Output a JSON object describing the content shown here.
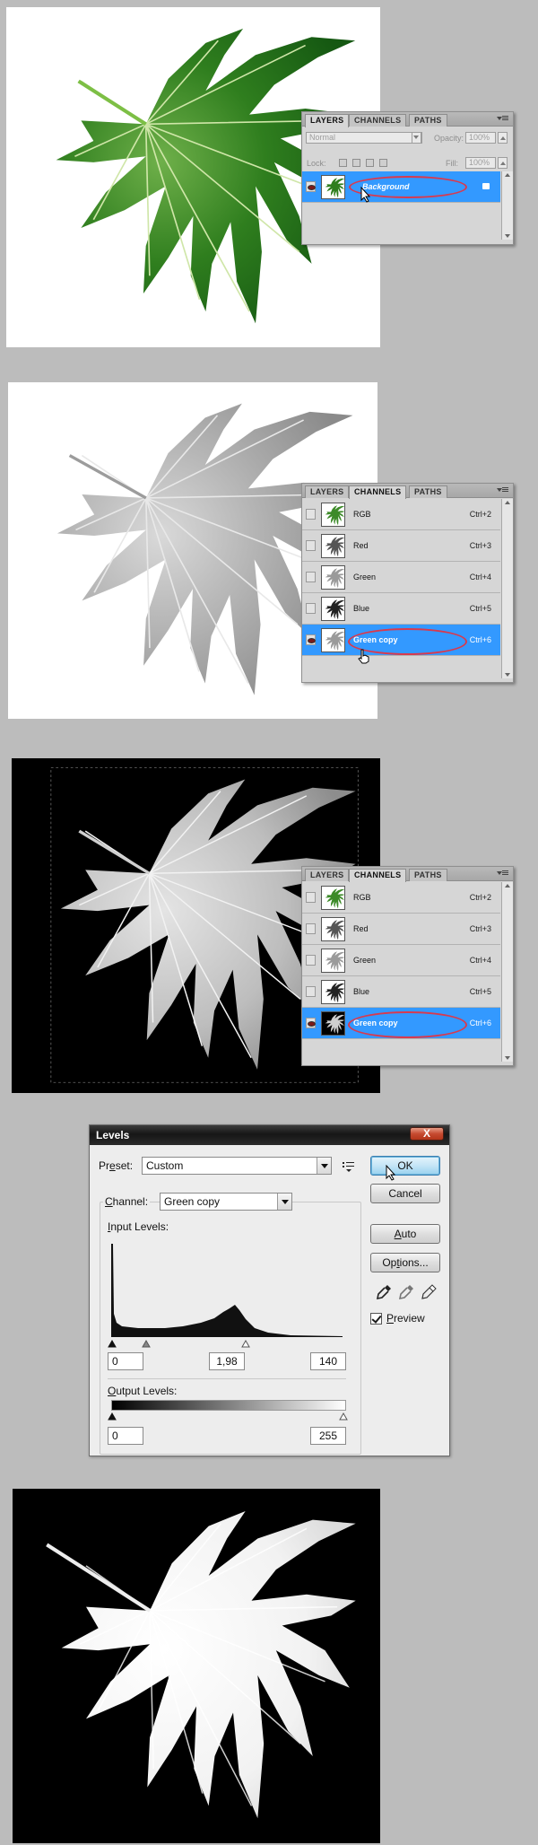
{
  "layers_panel": {
    "tabs": [
      "LAYERS",
      "CHANNELS",
      "PATHS"
    ],
    "blend_mode": "Normal",
    "opacity_label": "Opacity:",
    "opacity_value": "100%",
    "lock_label": "Lock:",
    "fill_label": "Fill:",
    "fill_value": "100%",
    "layer_name": "Background"
  },
  "channels_panel_1": {
    "tabs": [
      "LAYERS",
      "CHANNELS",
      "PATHS"
    ],
    "channels": [
      {
        "name": "RGB",
        "shortcut": "Ctrl+2"
      },
      {
        "name": "Red",
        "shortcut": "Ctrl+3"
      },
      {
        "name": "Green",
        "shortcut": "Ctrl+4"
      },
      {
        "name": "Blue",
        "shortcut": "Ctrl+5"
      },
      {
        "name": "Green copy",
        "shortcut": "Ctrl+6"
      }
    ]
  },
  "channels_panel_2": {
    "tabs": [
      "LAYERS",
      "CHANNELS",
      "PATHS"
    ],
    "channels": [
      {
        "name": "RGB",
        "shortcut": "Ctrl+2"
      },
      {
        "name": "Red",
        "shortcut": "Ctrl+3"
      },
      {
        "name": "Green",
        "shortcut": "Ctrl+4"
      },
      {
        "name": "Blue",
        "shortcut": "Ctrl+5"
      },
      {
        "name": "Green copy",
        "shortcut": "Ctrl+6"
      }
    ]
  },
  "levels_dialog": {
    "title": "Levels",
    "close": "X",
    "preset_label_pre": "Pr",
    "preset_label_u": "e",
    "preset_label_post": "set:",
    "preset_value": "Custom",
    "channel_label_u": "C",
    "channel_label_post": "hannel:",
    "channel_value": "Green copy",
    "input_levels_u": "I",
    "input_levels_post": "nput Levels:",
    "input_black": "0",
    "input_gamma": "1,98",
    "input_white": "140",
    "output_levels_u": "O",
    "output_levels_post": "utput Levels:",
    "output_black": "0",
    "output_white": "255",
    "ok": "OK",
    "cancel": "Cancel",
    "auto_u": "A",
    "auto_post": "uto",
    "options_pre": "Op",
    "options_u": "t",
    "options_post": "ions...",
    "preview_u": "P",
    "preview_post": "review",
    "preview_checked": true
  }
}
